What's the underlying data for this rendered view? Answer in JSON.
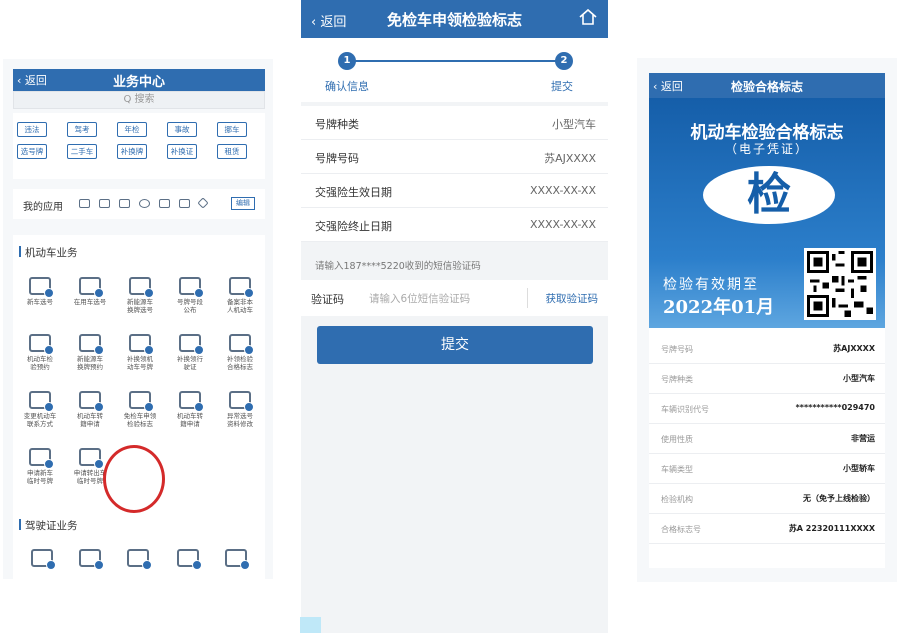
{
  "panel1": {
    "header": {
      "back_label": "返回",
      "title": "业务中心"
    },
    "search_placeholder": "Q 搜索",
    "tags": [
      "违法",
      "驾考",
      "年检",
      "事故",
      "挪车",
      "选号牌",
      "二手车",
      "补换牌",
      "补换证",
      "租赁"
    ],
    "my_apps": {
      "label": "我的应用",
      "edit_label": "编辑"
    },
    "section_vehicle": "机动车业务",
    "services": [
      "新车选号",
      "在用车选号",
      "新能源车\n换牌选号",
      "号牌号段\n公布",
      "备案非本\n人机动车",
      "机动车检\n验预约",
      "新能源车\n换牌预约",
      "补换领机\n动车号牌",
      "补换领行\n驶证",
      "补领检验\n合格标志",
      "变更机动车\n联系方式",
      "机动车转\n籍申请",
      "免检车申领\n检验标志",
      "机动车转\n籍申请",
      "异常选号\n资料修改",
      "申请新车\n临时号牌",
      "申请转出车\n临时号牌"
    ],
    "section_license": "驾驶证业务"
  },
  "panel2": {
    "header": {
      "back_label": "返回",
      "title": "免检车申领检验标志"
    },
    "steps": [
      {
        "num": "1",
        "label": "确认信息"
      },
      {
        "num": "2",
        "label": "提交"
      }
    ],
    "rows": [
      {
        "key": "号牌种类",
        "value": "小型汽车"
      },
      {
        "key": "号牌号码",
        "value": "苏AJXXXX"
      },
      {
        "key": "交强险生效日期",
        "value": "XXXX-XX-XX"
      },
      {
        "key": "交强险终止日期",
        "value": "XXXX-XX-XX"
      }
    ],
    "sms_hint": "请输入187****5220收到的短信验证码",
    "sms": {
      "label": "验证码",
      "placeholder": "请输入6位短信验证码",
      "button": "获取验证码"
    },
    "submit_label": "提交"
  },
  "panel3": {
    "header": {
      "back_label": "返回",
      "title": "检验合格标志"
    },
    "cert": {
      "title": "机动车检验合格标志",
      "subtitle": "（电子凭证）",
      "badge_char": "检",
      "valid_label": "检验有效期至",
      "valid_date": "2022年01月"
    },
    "rows": [
      {
        "key": "号牌号码",
        "value": "苏AJXXXX"
      },
      {
        "key": "号牌种类",
        "value": "小型汽车"
      },
      {
        "key": "车辆识别代号",
        "value": "***********029470"
      },
      {
        "key": "使用性质",
        "value": "非营运"
      },
      {
        "key": "车辆类型",
        "value": "小型轿车"
      },
      {
        "key": "检验机构",
        "value": "无（免予上线检验）"
      },
      {
        "key": "合格标志号",
        "value": "苏A 22320111XXXX"
      }
    ]
  },
  "colors": {
    "primary": "#2f6db0",
    "highlight_circle": "#d42a2a"
  }
}
